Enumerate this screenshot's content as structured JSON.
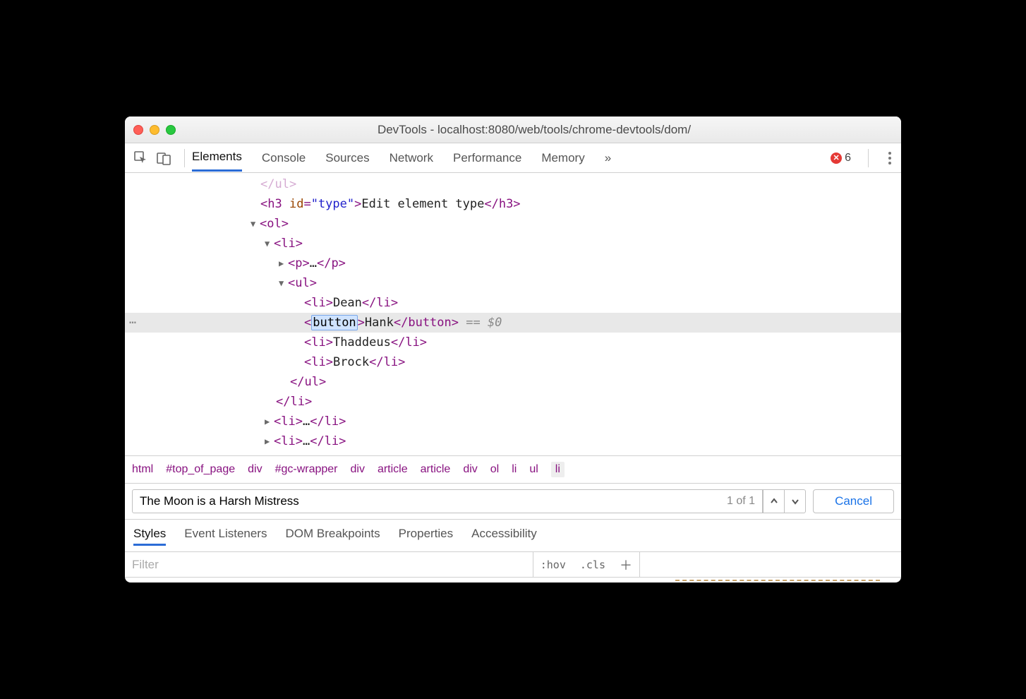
{
  "window": {
    "title": "DevTools - localhost:8080/web/tools/chrome-devtools/dom/"
  },
  "toolbar": {
    "tabs": [
      "Elements",
      "Console",
      "Sources",
      "Network",
      "Performance",
      "Memory"
    ],
    "active_tab": "Elements",
    "overflow": "»",
    "error_count": "6"
  },
  "dom": {
    "line0": {
      "tag_close": "</ul>"
    },
    "line1": {
      "open": "<h3 ",
      "attr_name": "id",
      "eq": "=",
      "attr_val": "\"type\"",
      "gt": ">",
      "text": "Edit element type",
      "close": "</h3>"
    },
    "line2": {
      "open": "<ol>",
      "tri": "▼"
    },
    "line3": {
      "open": "<li>",
      "tri": "▼"
    },
    "line4": {
      "open": "<p>",
      "ellip": "…",
      "close": "</p>",
      "tri": "▶"
    },
    "line5": {
      "open": "<ul>",
      "tri": "▼"
    },
    "line6": {
      "open": "<li>",
      "text": "Dean",
      "close": "</li>"
    },
    "line7": {
      "lt": "<",
      "edit": "button",
      "gt": ">",
      "text": "Hank",
      "close": "</button>",
      "sel": " == $0"
    },
    "line8": {
      "open": "<li>",
      "text": "Thaddeus",
      "close": "</li>"
    },
    "line9": {
      "open": "<li>",
      "text": "Brock",
      "close": "</li>"
    },
    "line10": {
      "close": "</ul>"
    },
    "line11": {
      "close": "</li>"
    },
    "line12": {
      "open": "<li>",
      "ellip": "…",
      "close": "</li>",
      "tri": "▶"
    },
    "line13": {
      "open": "<li>",
      "ellip": "…",
      "close": "</li>",
      "tri": "▶"
    }
  },
  "breadcrumbs": [
    "html",
    "#top_of_page",
    "div",
    "#gc-wrapper",
    "div",
    "article",
    "article",
    "div",
    "ol",
    "li",
    "ul",
    "li"
  ],
  "search": {
    "query": "The Moon is a Harsh Mistress",
    "match": "1 of 1",
    "cancel": "Cancel"
  },
  "subtabs": {
    "items": [
      "Styles",
      "Event Listeners",
      "DOM Breakpoints",
      "Properties",
      "Accessibility"
    ],
    "active": "Styles"
  },
  "styles_toolbar": {
    "filter_placeholder": "Filter",
    "hov": ":hov",
    "cls": ".cls"
  }
}
